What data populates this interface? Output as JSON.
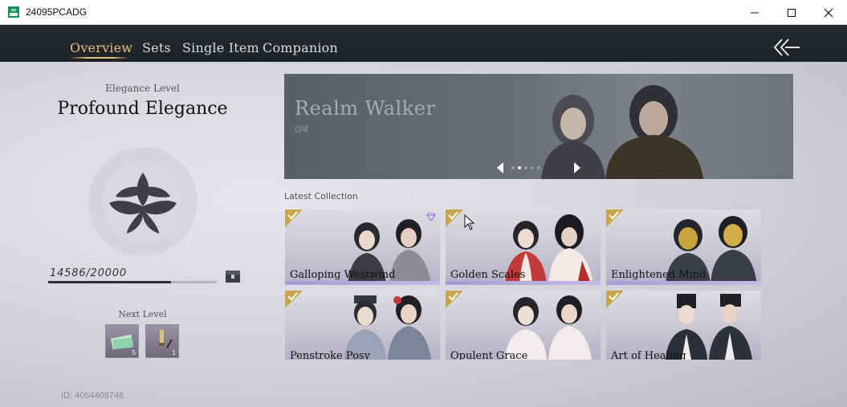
{
  "window": {
    "title": "24095PCADG",
    "controls": [
      "minimize-icon",
      "maximize-icon",
      "close-icon"
    ]
  },
  "nav": {
    "tabs": [
      {
        "label": "Overview",
        "active": true
      },
      {
        "label": "Sets",
        "active": false
      },
      {
        "label": "Single Item",
        "active": false
      },
      {
        "label": "Companion",
        "active": false
      }
    ],
    "back_icon": "back-arrow-icon"
  },
  "elegance": {
    "label": "Elegance Level",
    "title": "Profound Elegance",
    "emblem_icon": "lotus-emblem-icon",
    "progress_text": "14586/20000",
    "progress_fraction": 0.7293,
    "reward_icon": "chest-icon"
  },
  "next_level": {
    "label": "Next Level",
    "rewards": [
      {
        "icon": "cash-bundle-icon",
        "count": "5"
      },
      {
        "icon": "brush-icon",
        "count": "1"
      }
    ]
  },
  "player_id": "ID: 4054408746",
  "banner": {
    "title": "Realm Walker",
    "count": "0/4",
    "dots": 5,
    "active_dot": 1
  },
  "latest_collection": {
    "label": "Latest Collection",
    "cards": [
      {
        "name": "Galloping Westwind",
        "badge": true,
        "gem": true
      },
      {
        "name": "Golden Scales",
        "badge": true,
        "gem": false
      },
      {
        "name": "Enlightened Mind",
        "badge": true,
        "gem": false
      },
      {
        "name": "Penstroke Posy",
        "badge": true,
        "gem": false
      },
      {
        "name": "Opulent Grace",
        "badge": true,
        "gem": false
      },
      {
        "name": "Art of Healing",
        "badge": true,
        "gem": false
      }
    ]
  },
  "colors": {
    "accent": "#e7c180",
    "nav_bg": "#1f2227",
    "card_strip": "#b6a9e0",
    "badge": "#c9a64e"
  }
}
